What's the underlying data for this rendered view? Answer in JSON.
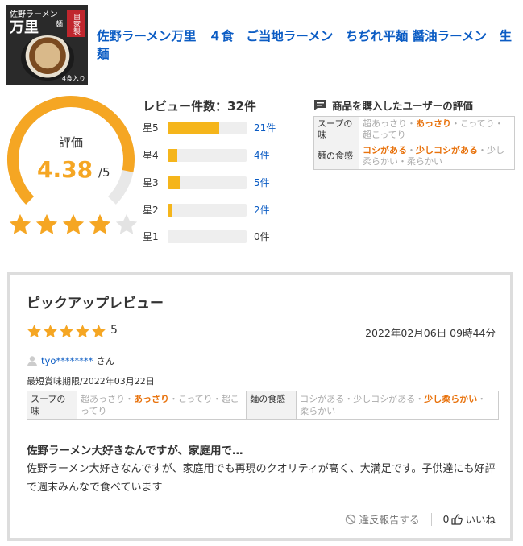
{
  "product": {
    "image": {
      "brand_small": "佐野ラーメン",
      "brand_big": "万里",
      "stamp": "自家製麺",
      "count_label": "4食入り"
    },
    "title": "佐野ラーメン万里　４食　ご当地ラーメン　ちぢれ平麺 醤油ラーメン　生麺"
  },
  "rating": {
    "label": "評価",
    "score": "4.38",
    "max": "/5",
    "stars_filled": 4,
    "stars_total": 5,
    "colors": {
      "accent": "#f5a623",
      "track": "#e8e8e8",
      "link": "#0b5cc4",
      "selected": "#e8720c"
    }
  },
  "distribution": {
    "title": "レビュー件数：32件",
    "rows": [
      {
        "label": "星5",
        "count_text": "21件",
        "count": 21
      },
      {
        "label": "星4",
        "count_text": "4件",
        "count": 4
      },
      {
        "label": "星3",
        "count_text": "5件",
        "count": 5
      },
      {
        "label": "星2",
        "count_text": "2件",
        "count": 2
      },
      {
        "label": "星1",
        "count_text": "0件",
        "count": 0
      }
    ],
    "total": 32
  },
  "buyer_eval": {
    "heading": "商品を購入したユーザーの評価",
    "rows": [
      {
        "key": "スープの味",
        "options": [
          {
            "text": "超あっさり",
            "selected": false
          },
          {
            "text": "あっさり",
            "selected": true
          },
          {
            "text": "こってり",
            "selected": false
          },
          {
            "text": "超こってり",
            "selected": false
          }
        ]
      },
      {
        "key": "麺の食感",
        "options": [
          {
            "text": "コシがある",
            "selected": true
          },
          {
            "text": "少しコシがある",
            "selected": true
          },
          {
            "text": "少し柔らかい",
            "selected": false
          },
          {
            "text": "柔らかい",
            "selected": false
          }
        ]
      }
    ]
  },
  "pickup": {
    "title": "ピックアップレビュー",
    "stars": 5,
    "score": "5",
    "date": "2022年02月06日 09時44分",
    "user": "tyo********",
    "user_suffix": "さん",
    "expiry": "最短賞味期限/2022年03月22日",
    "eval": [
      {
        "key": "スープの味",
        "options": [
          {
            "text": "超あっさり",
            "selected": false
          },
          {
            "text": "あっさり",
            "selected": true
          },
          {
            "text": "こってり",
            "selected": false
          },
          {
            "text": "超こってり",
            "selected": false
          }
        ]
      },
      {
        "key": "麺の食感",
        "options": [
          {
            "text": "コシがある",
            "selected": false
          },
          {
            "text": "少しコシがある",
            "selected": false
          },
          {
            "text": "少し柔らかい",
            "selected": true
          },
          {
            "text": "柔らかい",
            "selected": false
          }
        ]
      }
    ],
    "headline": "佐野ラーメン大好きなんですが、家庭用で…",
    "body": "佐野ラーメン大好きなんですが、家庭用でも再現のクオリティが高く、大満足です。子供達にも好評で週末みんなで食べています",
    "report_label": "違反報告する",
    "like_count": "0",
    "like_label": "いいね"
  }
}
